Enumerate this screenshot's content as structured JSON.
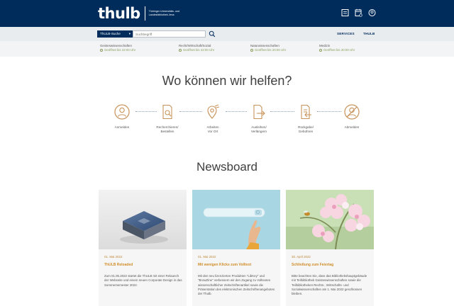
{
  "header": {
    "logo_word": "thulb",
    "logo_subtitle": "Thüringer Universitäts- und Landesbibliothek Jena",
    "icons": [
      "bookmark-icon",
      "calendar-icon",
      "user-icon"
    ]
  },
  "search": {
    "select_label": "ThULB-Suche",
    "placeholder": "Suchbegriff",
    "button_icon": "search-icon"
  },
  "nav": {
    "services": "SERVICES",
    "thulb": "THULB"
  },
  "opening_hours": [
    {
      "name": "Geisteswissenschaften",
      "time": "Geöffnet bis 22:00 Uhr"
    },
    {
      "name": "Recht/Wirtschaft/Sozial",
      "time": "Geöffnet bis 22:00 Uhr"
    },
    {
      "name": "Naturwissenschaften",
      "time": "Geöffnet bis 20:00 Uhr"
    },
    {
      "name": "Medizin",
      "time": "Geöffnet bis 20:00 Uhr"
    }
  ],
  "help": {
    "title": "Wo können wir helfen?",
    "steps": [
      {
        "label": "Anmelden",
        "icon": "person-icon"
      },
      {
        "label": "Recherchieren/\nBestellen",
        "icon": "document-search-icon"
      },
      {
        "label": "Arbeiten\nVor Ort",
        "icon": "location-icon"
      },
      {
        "label": "Ausleihen/\nVerlängern",
        "icon": "document-arrow-icon"
      },
      {
        "label": "Rückgabe/\nGebühren",
        "icon": "document-return-icon"
      },
      {
        "label": "Abmelden",
        "icon": "logout-icon"
      }
    ]
  },
  "news": {
    "title": "Newsboard",
    "cards": [
      {
        "date": "01. Mai 2022",
        "title": "ThULB Reloaded",
        "text": "Zum 01.05.2022 startet die ThULB mit einer Relaunch der Webseite und einem neuen Corporate Design in das Sommersemester 2022."
      },
      {
        "date": "01. Mai 2022",
        "title": "Mit wenigen Klicks zum Volltext",
        "text": "Mit den neu lizenzierten Produkten \"LibKey\" und \"BrowZine\" verbessern wir den Zugang zu Volltexten wissenschaftlicher Zeitschriftenartikel sowie die Präsentation des elektronischen Zeitschriftenangebotes der Thulb."
      },
      {
        "date": "30. April 2022",
        "title": "Schließung zum Feiertag",
        "text": "Bitte beachten Sie, dass das Bibliothekshauptgebäude mit Teilbibliothek Geisteswissenschaften sowie die Teilbibliotheken Rechts-, Wirtschafts- und Sozialwissenschaften am 1. Mai 2022 geschlossen bleiben."
      }
    ]
  },
  "colors": {
    "header_bg": "#002c5c",
    "accent_orange": "#d18d2a",
    "step_icon": "#c8935a",
    "hours_green": "#8a9f5e"
  }
}
